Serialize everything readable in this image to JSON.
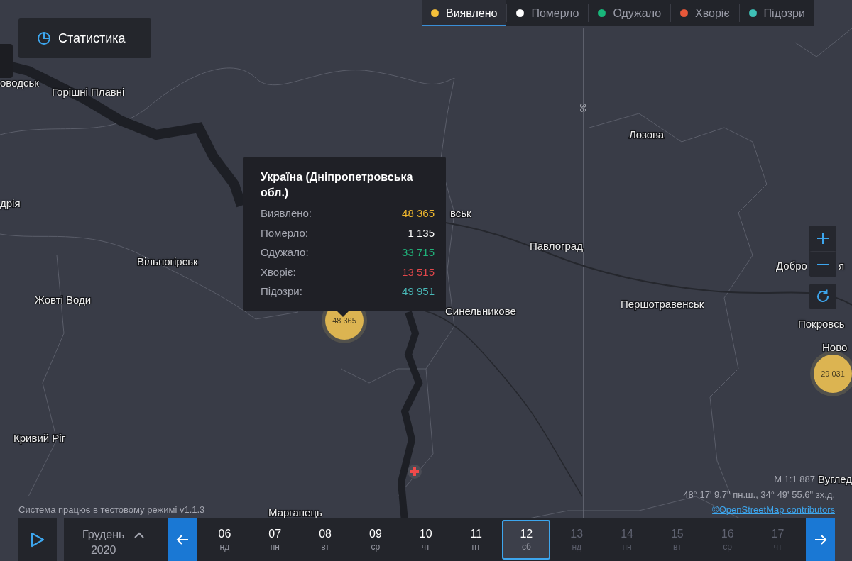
{
  "stats_button": {
    "label": "Статистика"
  },
  "legend": [
    {
      "label": "Виявлено",
      "color": "#f5c03a",
      "selected": true
    },
    {
      "label": "Померло",
      "color": "#ffffff",
      "selected": false
    },
    {
      "label": "Одужало",
      "color": "#18b67a",
      "selected": false
    },
    {
      "label": "Хворіє",
      "color": "#e8583a",
      "selected": false
    },
    {
      "label": "Підозри",
      "color": "#3ec0b6",
      "selected": false
    }
  ],
  "map": {
    "places": [
      "оводськ",
      "Горішні Плавні",
      "Лозова",
      "дрія",
      "вськ",
      "Павлоград",
      "Вільногірськ",
      "Жовті Води",
      "Синельникове",
      "Першотравенськ",
      "Добро",
      "я",
      "Покровсь",
      "Ново",
      "Кривий Ріг",
      "Марганець",
      "Вуглед"
    ],
    "road_label": "36",
    "clusters": [
      "48 365",
      "29 031"
    ]
  },
  "tooltip": {
    "title": "Україна (Дніпропетровська обл.)",
    "rows": [
      {
        "label": "Виявлено:",
        "value": "48 365",
        "color": "#f2b92e"
      },
      {
        "label": "Померло:",
        "value": "1 135",
        "color": "#ffffff"
      },
      {
        "label": "Одужало:",
        "value": "33 715",
        "color": "#20b27a"
      },
      {
        "label": "Хворіє:",
        "value": "13 515",
        "color": "#e2474b"
      },
      {
        "label": "Підозри:",
        "value": "49 951",
        "color": "#49b9b8"
      }
    ]
  },
  "notice": "Система працює в тестовому режимі v1.1.3",
  "scale": "М 1:1 887",
  "coordinates": "48° 17' 9.7\" пн.ш., 34° 49' 55.6\" зх.д,",
  "attribution": "©OpenStreetMap contributors",
  "timeline": {
    "month": "Грудень",
    "year": "2020",
    "days": [
      {
        "day": "06",
        "weekday": "нд",
        "selected": false,
        "disabled": false
      },
      {
        "day": "07",
        "weekday": "пн",
        "selected": false,
        "disabled": false
      },
      {
        "day": "08",
        "weekday": "вт",
        "selected": false,
        "disabled": false
      },
      {
        "day": "09",
        "weekday": "ср",
        "selected": false,
        "disabled": false
      },
      {
        "day": "10",
        "weekday": "чт",
        "selected": false,
        "disabled": false
      },
      {
        "day": "11",
        "weekday": "пт",
        "selected": false,
        "disabled": false
      },
      {
        "day": "12",
        "weekday": "сб",
        "selected": true,
        "disabled": false
      },
      {
        "day": "13",
        "weekday": "нд",
        "selected": false,
        "disabled": true
      },
      {
        "day": "14",
        "weekday": "пн",
        "selected": false,
        "disabled": true
      },
      {
        "day": "15",
        "weekday": "вт",
        "selected": false,
        "disabled": true
      },
      {
        "day": "16",
        "weekday": "ср",
        "selected": false,
        "disabled": true
      },
      {
        "day": "17",
        "weekday": "чт",
        "selected": false,
        "disabled": true
      }
    ]
  }
}
